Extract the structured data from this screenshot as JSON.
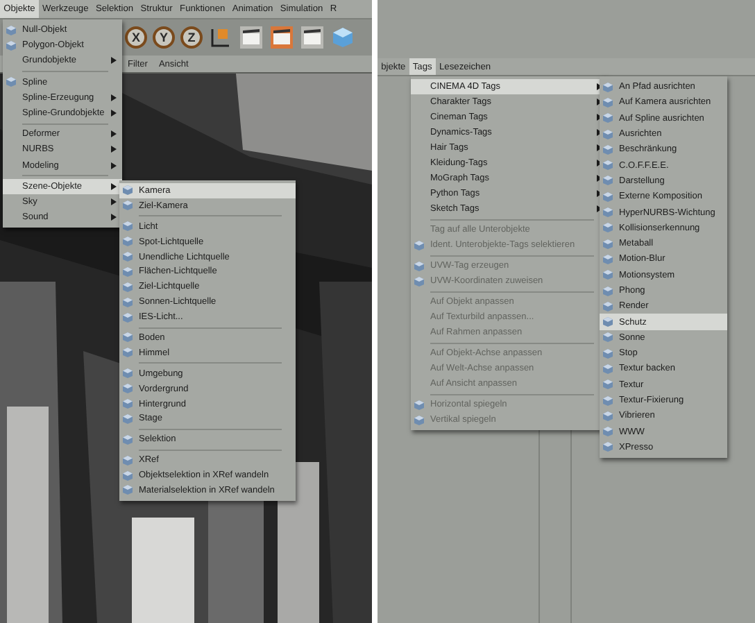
{
  "left": {
    "menubar": [
      {
        "label": "Objekte",
        "selected": true
      },
      {
        "label": "Werkzeuge",
        "selected": false
      },
      {
        "label": "Selektion",
        "selected": false
      },
      {
        "label": "Struktur",
        "selected": false
      },
      {
        "label": "Funktionen",
        "selected": false
      },
      {
        "label": "Animation",
        "selected": false
      },
      {
        "label": "Simulation",
        "selected": false
      },
      {
        "label": "R",
        "selected": false
      }
    ],
    "axis_buttons": [
      "X",
      "Y",
      "Z"
    ],
    "view_menu": [
      "Filter",
      "Ansicht"
    ],
    "menu": {
      "groups": [
        [
          {
            "label": "Null-Objekt",
            "icon": true,
            "submenu": false,
            "selected": false
          },
          {
            "label": "Polygon-Objekt",
            "icon": true,
            "submenu": false,
            "selected": false
          },
          {
            "label": "Grundobjekte",
            "icon": false,
            "submenu": true,
            "selected": false
          }
        ],
        [
          {
            "label": "Spline",
            "icon": true,
            "submenu": false,
            "selected": false
          },
          {
            "label": "Spline-Erzeugung",
            "icon": false,
            "submenu": true,
            "selected": false
          },
          {
            "label": "Spline-Grundobjekte",
            "icon": false,
            "submenu": true,
            "selected": false
          }
        ],
        [
          {
            "label": "Deformer",
            "icon": false,
            "submenu": true,
            "selected": false
          },
          {
            "label": "NURBS",
            "icon": false,
            "submenu": true,
            "selected": false
          },
          {
            "label": "Modeling",
            "icon": false,
            "submenu": true,
            "selected": false
          }
        ],
        [
          {
            "label": "Szene-Objekte",
            "icon": false,
            "submenu": true,
            "selected": true
          },
          {
            "label": "Sky",
            "icon": false,
            "submenu": true,
            "selected": false
          },
          {
            "label": "Sound",
            "icon": false,
            "submenu": true,
            "selected": false
          }
        ]
      ]
    },
    "submenu": {
      "groups": [
        [
          {
            "label": "Kamera",
            "icon": true,
            "selected": true
          },
          {
            "label": "Ziel-Kamera",
            "icon": true,
            "selected": false
          }
        ],
        [
          {
            "label": "Licht",
            "icon": true,
            "selected": false
          },
          {
            "label": "Spot-Lichtquelle",
            "icon": true,
            "selected": false
          },
          {
            "label": "Unendliche Lichtquelle",
            "icon": true,
            "selected": false
          },
          {
            "label": "Flächen-Lichtquelle",
            "icon": true,
            "selected": false
          },
          {
            "label": "Ziel-Lichtquelle",
            "icon": true,
            "selected": false
          },
          {
            "label": "Sonnen-Lichtquelle",
            "icon": true,
            "selected": false
          },
          {
            "label": "IES-Licht...",
            "icon": true,
            "selected": false
          }
        ],
        [
          {
            "label": "Boden",
            "icon": true,
            "selected": false
          },
          {
            "label": "Himmel",
            "icon": true,
            "selected": false
          }
        ],
        [
          {
            "label": "Umgebung",
            "icon": true,
            "selected": false
          },
          {
            "label": "Vordergrund",
            "icon": true,
            "selected": false
          },
          {
            "label": "Hintergrund",
            "icon": true,
            "selected": false
          },
          {
            "label": "Stage",
            "icon": true,
            "selected": false
          }
        ],
        [
          {
            "label": "Selektion",
            "icon": true,
            "selected": false
          }
        ],
        [
          {
            "label": "XRef",
            "icon": true,
            "selected": false
          },
          {
            "label": "Objektselektion in XRef wandeln",
            "icon": true,
            "selected": false
          },
          {
            "label": "Materialselektion in XRef wandeln",
            "icon": true,
            "selected": false
          }
        ]
      ]
    }
  },
  "right": {
    "menubar": [
      {
        "label": "bjekte",
        "selected": false
      },
      {
        "label": "Tags",
        "selected": true
      },
      {
        "label": "Lesezeichen",
        "selected": false
      }
    ],
    "menu": {
      "groups": [
        [
          {
            "label": "CINEMA 4D Tags",
            "icon": false,
            "submenu": true,
            "selected": true,
            "disabled": false
          },
          {
            "label": "Charakter Tags",
            "icon": false,
            "submenu": true,
            "selected": false,
            "disabled": false
          },
          {
            "label": "Cineman Tags",
            "icon": false,
            "submenu": true,
            "selected": false,
            "disabled": false
          },
          {
            "label": "Dynamics-Tags",
            "icon": false,
            "submenu": true,
            "selected": false,
            "disabled": false
          },
          {
            "label": "Hair Tags",
            "icon": false,
            "submenu": true,
            "selected": false,
            "disabled": false
          },
          {
            "label": "Kleidung-Tags",
            "icon": false,
            "submenu": true,
            "selected": false,
            "disabled": false
          },
          {
            "label": "MoGraph Tags",
            "icon": false,
            "submenu": true,
            "selected": false,
            "disabled": false
          },
          {
            "label": "Python Tags",
            "icon": false,
            "submenu": true,
            "selected": false,
            "disabled": false
          },
          {
            "label": "Sketch Tags",
            "icon": false,
            "submenu": true,
            "selected": false,
            "disabled": false
          }
        ],
        [
          {
            "label": "Tag auf alle Unterobjekte",
            "icon": false,
            "submenu": false,
            "selected": false,
            "disabled": true
          },
          {
            "label": "Ident. Unterobjekte-Tags selektieren",
            "icon": true,
            "submenu": false,
            "selected": false,
            "disabled": true
          }
        ],
        [
          {
            "label": "UVW-Tag erzeugen",
            "icon": true,
            "submenu": false,
            "selected": false,
            "disabled": true
          },
          {
            "label": "UVW-Koordinaten zuweisen",
            "icon": true,
            "submenu": false,
            "selected": false,
            "disabled": true
          }
        ],
        [
          {
            "label": "Auf Objekt anpassen",
            "icon": false,
            "submenu": false,
            "selected": false,
            "disabled": true
          },
          {
            "label": "Auf Texturbild anpassen...",
            "icon": false,
            "submenu": false,
            "selected": false,
            "disabled": true
          },
          {
            "label": "Auf Rahmen anpassen",
            "icon": false,
            "submenu": false,
            "selected": false,
            "disabled": true
          }
        ],
        [
          {
            "label": "Auf Objekt-Achse anpassen",
            "icon": false,
            "submenu": false,
            "selected": false,
            "disabled": true
          },
          {
            "label": "Auf Welt-Achse anpassen",
            "icon": false,
            "submenu": false,
            "selected": false,
            "disabled": true
          },
          {
            "label": "Auf Ansicht anpassen",
            "icon": false,
            "submenu": false,
            "selected": false,
            "disabled": true
          }
        ],
        [
          {
            "label": "Horizontal spiegeln",
            "icon": true,
            "submenu": false,
            "selected": false,
            "disabled": true
          },
          {
            "label": "Vertikal spiegeln",
            "icon": true,
            "submenu": false,
            "selected": false,
            "disabled": true
          }
        ]
      ]
    },
    "submenu": {
      "groups": [
        [
          {
            "label": "An Pfad ausrichten",
            "icon": true,
            "selected": false
          },
          {
            "label": "Auf Kamera ausrichten",
            "icon": true,
            "selected": false
          },
          {
            "label": "Auf Spline ausrichten",
            "icon": true,
            "selected": false
          },
          {
            "label": "Ausrichten",
            "icon": true,
            "selected": false
          },
          {
            "label": "Beschränkung",
            "icon": true,
            "selected": false
          },
          {
            "label": "C.O.F.F.E.E.",
            "icon": true,
            "selected": false
          },
          {
            "label": "Darstellung",
            "icon": true,
            "selected": false
          },
          {
            "label": "Externe Komposition",
            "icon": true,
            "selected": false
          },
          {
            "label": "HyperNURBS-Wichtung",
            "icon": true,
            "selected": false
          },
          {
            "label": "Kollisionserkennung",
            "icon": true,
            "selected": false
          },
          {
            "label": "Metaball",
            "icon": true,
            "selected": false
          },
          {
            "label": "Motion-Blur",
            "icon": true,
            "selected": false
          },
          {
            "label": "Motionsystem",
            "icon": true,
            "selected": false
          },
          {
            "label": "Phong",
            "icon": true,
            "selected": false
          },
          {
            "label": "Render",
            "icon": true,
            "selected": false
          },
          {
            "label": "Schutz",
            "icon": true,
            "selected": true
          },
          {
            "label": "Sonne",
            "icon": true,
            "selected": false
          },
          {
            "label": "Stop",
            "icon": true,
            "selected": false
          },
          {
            "label": "Textur backen",
            "icon": true,
            "selected": false
          },
          {
            "label": "Textur",
            "icon": true,
            "selected": false
          },
          {
            "label": "Textur-Fixierung",
            "icon": true,
            "selected": false
          },
          {
            "label": "Vibrieren",
            "icon": true,
            "selected": false
          },
          {
            "label": "WWW",
            "icon": true,
            "selected": false
          },
          {
            "label": "XPresso",
            "icon": true,
            "selected": false
          }
        ]
      ]
    }
  }
}
